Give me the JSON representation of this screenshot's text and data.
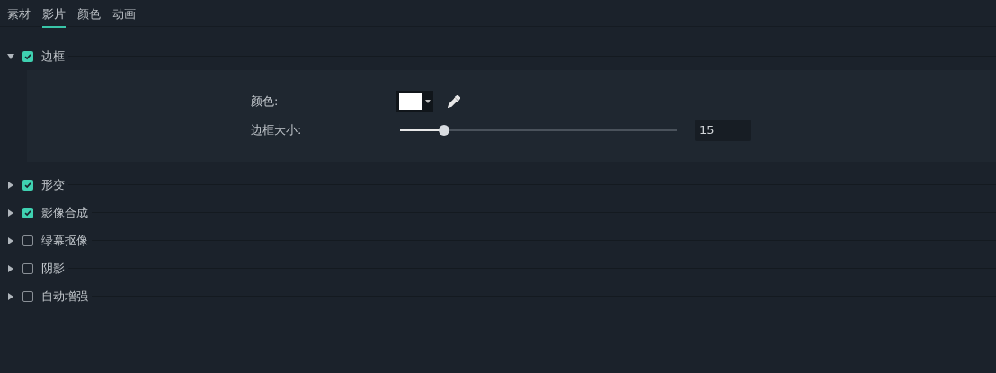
{
  "tabs": [
    {
      "label": "素材",
      "selected": false
    },
    {
      "label": "影片",
      "selected": true
    },
    {
      "label": "颜色",
      "selected": false
    },
    {
      "label": "动画",
      "selected": false
    }
  ],
  "sections": [
    {
      "label": "边框",
      "checked": true,
      "expanded": true,
      "color_label": "颜色:",
      "size_label": "边框大小:",
      "size_slider": {
        "level": 0.16
      },
      "size_value": "15"
    },
    {
      "label": "形变",
      "checked": true,
      "expanded": false
    },
    {
      "label": "影像合成",
      "checked": true,
      "expanded": false
    },
    {
      "label": "绿幕抠像",
      "checked": false,
      "expanded": false
    },
    {
      "label": "阴影",
      "checked": false,
      "expanded": false
    },
    {
      "label": "自动增强",
      "checked": false,
      "expanded": false
    }
  ]
}
